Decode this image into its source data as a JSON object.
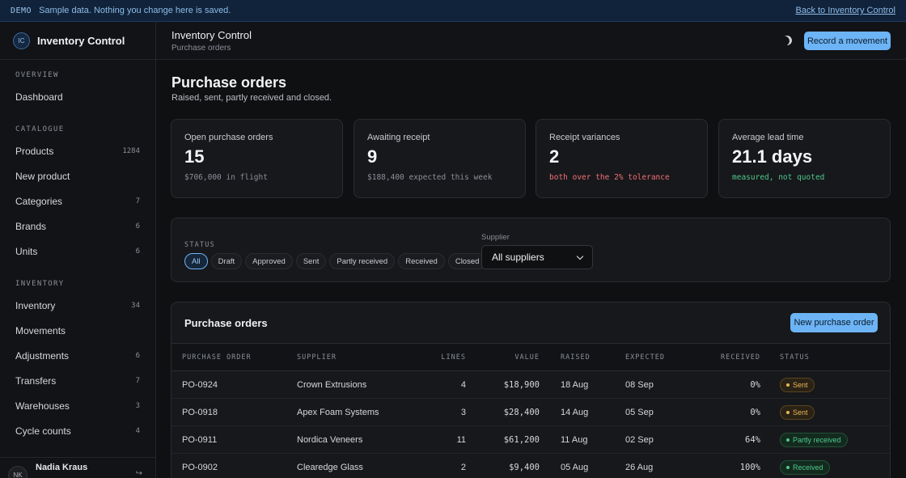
{
  "banner": {
    "tag": "DEMO",
    "message": "Sample data. Nothing you change here is saved.",
    "back_link": "Back to Inventory Control"
  },
  "brand": {
    "initials": "IC",
    "name": "Inventory Control"
  },
  "sidebar": {
    "sections": [
      "OVERVIEW",
      "CATALOGUE",
      "INVENTORY"
    ],
    "items": [
      {
        "label": "Dashboard",
        "count": ""
      },
      {
        "label": "Products",
        "count": "1284"
      },
      {
        "label": "New product",
        "count": ""
      },
      {
        "label": "Categories",
        "count": "7"
      },
      {
        "label": "Brands",
        "count": "6"
      },
      {
        "label": "Units",
        "count": "6"
      },
      {
        "label": "Inventory",
        "count": "34"
      },
      {
        "label": "Movements",
        "count": ""
      },
      {
        "label": "Adjustments",
        "count": "6"
      },
      {
        "label": "Transfers",
        "count": "7"
      },
      {
        "label": "Warehouses",
        "count": "3"
      },
      {
        "label": "Cycle counts",
        "count": "4"
      }
    ],
    "user": {
      "initials": "NK",
      "name": "Nadia Kraus"
    }
  },
  "topbar": {
    "title": "Inventory Control",
    "subtitle": "Purchase orders",
    "record_button": "Record a movement"
  },
  "page": {
    "title": "Purchase orders",
    "subtitle": "Raised, sent, partly received and closed."
  },
  "kpis": [
    {
      "label": "Open purchase orders",
      "value": "15",
      "note": "$706,000 in flight"
    },
    {
      "label": "Awaiting receipt",
      "value": "9",
      "note": "$188,400 expected this week"
    },
    {
      "label": "Receipt variances",
      "value": "2",
      "note": "both over the 2% tolerance"
    },
    {
      "label": "Average lead time",
      "value": "21.1 days",
      "note": "measured, not quoted"
    }
  ],
  "filters": {
    "status_label": "STATUS",
    "chips": [
      "All",
      "Draft",
      "Approved",
      "Sent",
      "Partly received",
      "Received",
      "Closed"
    ],
    "active_chip": "All",
    "supplier_label": "Supplier",
    "supplier_value": "All suppliers"
  },
  "table": {
    "title": "Purchase orders",
    "new_button": "New purchase order",
    "columns": [
      "PURCHASE ORDER",
      "SUPPLIER",
      "LINES",
      "VALUE",
      "RAISED",
      "EXPECTED",
      "RECEIVED",
      "STATUS"
    ],
    "rows": [
      {
        "po": "PO-0924",
        "supplier": "Crown Extrusions",
        "lines": "4",
        "value": "$18,900",
        "raised": "18 Aug",
        "expected": "08 Sep",
        "received": "0%",
        "status": "Sent"
      },
      {
        "po": "PO-0918",
        "supplier": "Apex Foam Systems",
        "lines": "3",
        "value": "$28,400",
        "raised": "14 Aug",
        "expected": "05 Sep",
        "received": "0%",
        "status": "Sent"
      },
      {
        "po": "PO-0911",
        "supplier": "Nordica Veneers",
        "lines": "11",
        "value": "$61,200",
        "raised": "11 Aug",
        "expected": "02 Sep",
        "received": "64%",
        "status": "Partly received"
      },
      {
        "po": "PO-0902",
        "supplier": "Clearedge Glass",
        "lines": "2",
        "value": "$9,400",
        "raised": "05 Aug",
        "expected": "26 Aug",
        "received": "100%",
        "status": "Received"
      }
    ]
  }
}
